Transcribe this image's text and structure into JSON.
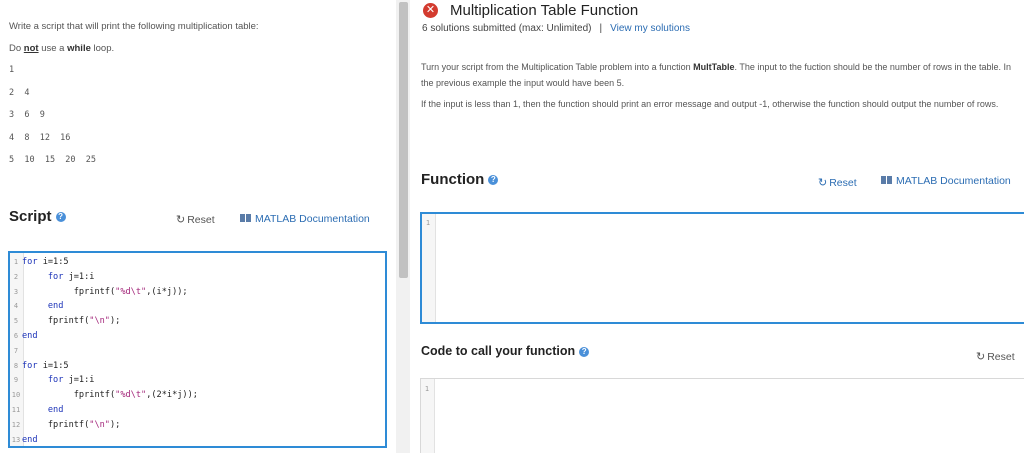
{
  "left": {
    "intro": "Write a script that will print the following multiplication table:",
    "nowhile_pre": "Do ",
    "nowhile_not": "not",
    "nowhile_mid": " use a ",
    "nowhile_bold": "while",
    "nowhile_post": " loop.",
    "table_rows": [
      "1",
      "2  4",
      "3  6  9",
      "4  8  12  16",
      "5  10  15  20  25"
    ],
    "script_title": "Script",
    "reset_label": "Reset",
    "docs_label": "MATLAB Documentation",
    "code_lines": [
      {
        "n": "1",
        "indent": "",
        "kw": "for",
        "rest": " i=1:5"
      },
      {
        "n": "2",
        "indent": "     ",
        "kw": "for",
        "rest": " j=1:i"
      },
      {
        "n": "3",
        "indent": "          ",
        "kw": "",
        "rest": "fprintf(",
        "str": "\"%d\\t\"",
        "tail": ",(i*j));"
      },
      {
        "n": "4",
        "indent": "     ",
        "kw": "end",
        "rest": ""
      },
      {
        "n": "5",
        "indent": "     ",
        "kw": "",
        "rest": "fprintf(",
        "str": "\"\\n\"",
        "tail": ");"
      },
      {
        "n": "6",
        "indent": "",
        "kw": "end",
        "rest": ""
      },
      {
        "n": "7",
        "indent": "",
        "kw": "",
        "rest": ""
      },
      {
        "n": "8",
        "indent": "",
        "kw": "for",
        "rest": " i=1:5"
      },
      {
        "n": "9",
        "indent": "     ",
        "kw": "for",
        "rest": " j=1:i"
      },
      {
        "n": "10",
        "indent": "          ",
        "kw": "",
        "rest": "fprintf(",
        "str": "\"%d\\t\"",
        "tail": ",(2*i*j));"
      },
      {
        "n": "11",
        "indent": "     ",
        "kw": "end",
        "rest": ""
      },
      {
        "n": "12",
        "indent": "     ",
        "kw": "",
        "rest": "fprintf(",
        "str": "\"\\n\"",
        "tail": ");"
      },
      {
        "n": "13",
        "indent": "",
        "kw": "end",
        "rest": ""
      }
    ]
  },
  "right": {
    "title": "Multiplication Table Function",
    "submitted": "6 solutions submitted (max: Unlimited)",
    "separator": "|",
    "view_solutions": "View my solutions",
    "para1_pre": "Turn your script from the Multiplication Table problem into a function ",
    "para1_bold": "MultTable",
    "para1_post": ". The input to the fuction should be the number of rows in the table. In the previous example the input would have been 5.",
    "para2": "If the input is less than 1, then the function should print an error message and output -1, otherwise the function should output the number of rows.",
    "function_title": "Function",
    "function_reset": "Reset",
    "function_docs": "MATLAB Documentation",
    "function_line": "1",
    "call_title": "Code to call your function",
    "call_reset": "Reset",
    "call_line": "1"
  },
  "icons": {
    "error": "x-circle-icon",
    "help": "question-circle-icon",
    "reset": "refresh-icon",
    "docs": "documentation-icon"
  },
  "colors": {
    "accent": "#2e8bd6",
    "link": "#2c6db3",
    "error": "#d33b2f",
    "keyword": "#1b32b8",
    "string": "#a4287b"
  }
}
